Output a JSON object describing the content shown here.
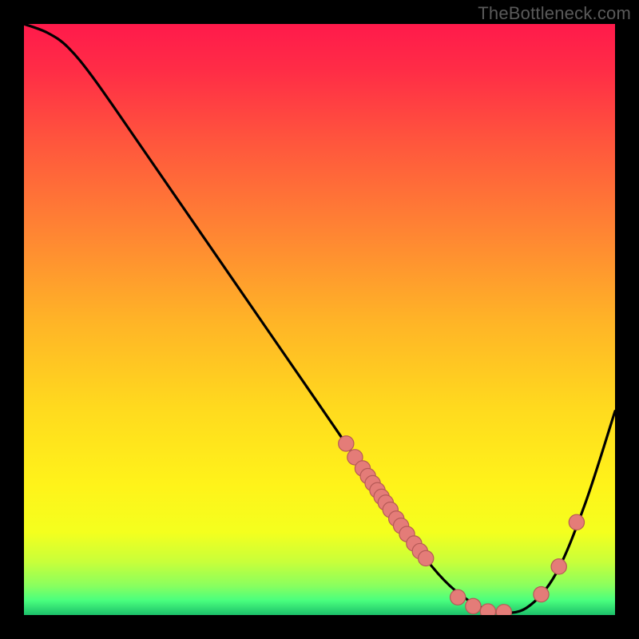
{
  "attribution": "TheBottleneck.com",
  "colors": {
    "gradient_stops": [
      {
        "offset": 0.0,
        "color": "#ff1a4b"
      },
      {
        "offset": 0.08,
        "color": "#ff2d46"
      },
      {
        "offset": 0.2,
        "color": "#ff563d"
      },
      {
        "offset": 0.35,
        "color": "#ff8433"
      },
      {
        "offset": 0.5,
        "color": "#ffb327"
      },
      {
        "offset": 0.65,
        "color": "#ffda1e"
      },
      {
        "offset": 0.78,
        "color": "#fff31a"
      },
      {
        "offset": 0.86,
        "color": "#f4ff1e"
      },
      {
        "offset": 0.91,
        "color": "#c8ff3a"
      },
      {
        "offset": 0.95,
        "color": "#8aff5e"
      },
      {
        "offset": 0.975,
        "color": "#4aff7e"
      },
      {
        "offset": 1.0,
        "color": "#1cc06a"
      }
    ],
    "curve": "#000000",
    "markers_fill": "#e47c78",
    "markers_stroke": "#b65a57",
    "background": "#000000"
  },
  "chart_data": {
    "type": "line",
    "title": "",
    "xlabel": "",
    "ylabel": "",
    "xlim": [
      0,
      1
    ],
    "ylim": [
      0,
      1
    ],
    "series": [
      {
        "name": "bottleneck-curve",
        "x": [
          0.0,
          0.04,
          0.075,
          0.12,
          0.2,
          0.3,
          0.4,
          0.5,
          0.55,
          0.62,
          0.68,
          0.72,
          0.76,
          0.8,
          0.85,
          0.9,
          0.95,
          1.0
        ],
        "y": [
          1.0,
          0.985,
          0.96,
          0.905,
          0.79,
          0.645,
          0.5,
          0.355,
          0.282,
          0.18,
          0.095,
          0.05,
          0.02,
          0.005,
          0.012,
          0.07,
          0.19,
          0.345
        ]
      }
    ],
    "markers": [
      {
        "x": 0.545,
        "y": 0.29
      },
      {
        "x": 0.56,
        "y": 0.267
      },
      {
        "x": 0.573,
        "y": 0.248
      },
      {
        "x": 0.582,
        "y": 0.235
      },
      {
        "x": 0.59,
        "y": 0.223
      },
      {
        "x": 0.598,
        "y": 0.211
      },
      {
        "x": 0.605,
        "y": 0.2
      },
      {
        "x": 0.612,
        "y": 0.19
      },
      {
        "x": 0.62,
        "y": 0.178
      },
      {
        "x": 0.63,
        "y": 0.163
      },
      {
        "x": 0.638,
        "y": 0.151
      },
      {
        "x": 0.648,
        "y": 0.137
      },
      {
        "x": 0.66,
        "y": 0.121
      },
      {
        "x": 0.67,
        "y": 0.108
      },
      {
        "x": 0.68,
        "y": 0.096
      },
      {
        "x": 0.734,
        "y": 0.03
      },
      {
        "x": 0.76,
        "y": 0.015
      },
      {
        "x": 0.785,
        "y": 0.006
      },
      {
        "x": 0.812,
        "y": 0.005
      },
      {
        "x": 0.875,
        "y": 0.035
      },
      {
        "x": 0.905,
        "y": 0.082
      },
      {
        "x": 0.935,
        "y": 0.157
      }
    ],
    "marker_radius_norm": 0.013
  }
}
